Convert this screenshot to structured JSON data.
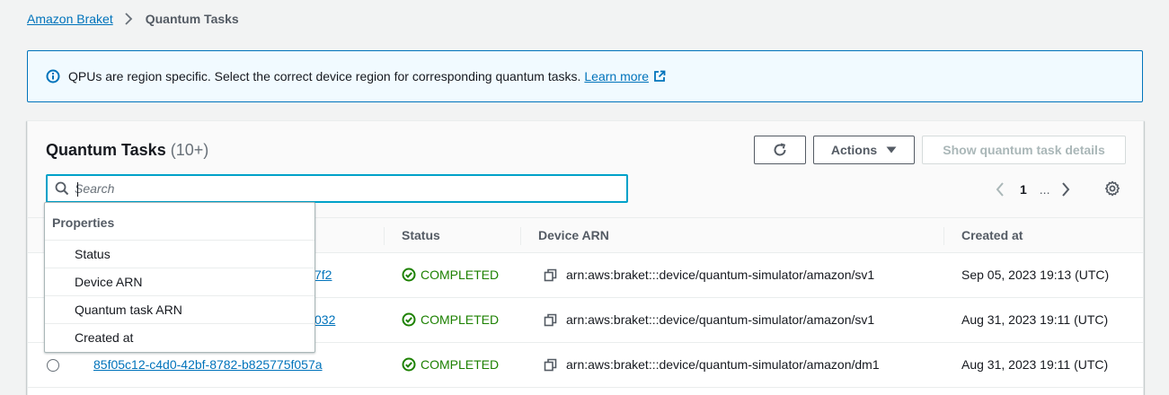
{
  "breadcrumb": {
    "root": "Amazon Braket",
    "current": "Quantum Tasks"
  },
  "banner": {
    "message": "QPUs are region specific. Select the correct device region for corresponding quantum tasks.",
    "link": "Learn more"
  },
  "panel": {
    "title": "Quantum Tasks",
    "count": "(10+)",
    "actions_label": "Actions",
    "details_label": "Show quantum task details"
  },
  "search": {
    "placeholder": "Search",
    "value": ""
  },
  "pagination": {
    "current": "1",
    "ellipsis": "..."
  },
  "table": {
    "columns": [
      "Status",
      "Device ARN",
      "Created at"
    ],
    "rows": [
      {
        "task_tail": "7f2",
        "status": "COMPLETED",
        "device_arn": "arn:aws:braket:::device/quantum-simulator/amazon/sv1",
        "created_at": "Sep 05, 2023 19:13 (UTC)"
      },
      {
        "task_tail": "032",
        "status": "COMPLETED",
        "device_arn": "arn:aws:braket:::device/quantum-simulator/amazon/sv1",
        "created_at": "Aug 31, 2023 19:11 (UTC)"
      },
      {
        "task_id": "85f05c12-c4d0-42bf-8782-b825775f057a",
        "status": "COMPLETED",
        "device_arn": "arn:aws:braket:::device/quantum-simulator/amazon/dm1",
        "created_at": "Aug 31, 2023 19:11 (UTC)"
      }
    ]
  },
  "properties_dropdown": {
    "title": "Properties",
    "items": [
      "Status",
      "Device ARN",
      "Quantum task ARN",
      "Created at"
    ]
  },
  "icons": {
    "info": "info-icon",
    "external": "external-link-icon",
    "refresh": "refresh-icon",
    "caret": "caret-down-icon",
    "search": "search-icon",
    "settings": "gear-icon",
    "status": "check-circle-icon",
    "copy": "copy-icon"
  },
  "colors": {
    "link": "#0073bb",
    "success": "#1d8102",
    "banner_bg": "#f1faff",
    "focus": "#00a1c9"
  }
}
